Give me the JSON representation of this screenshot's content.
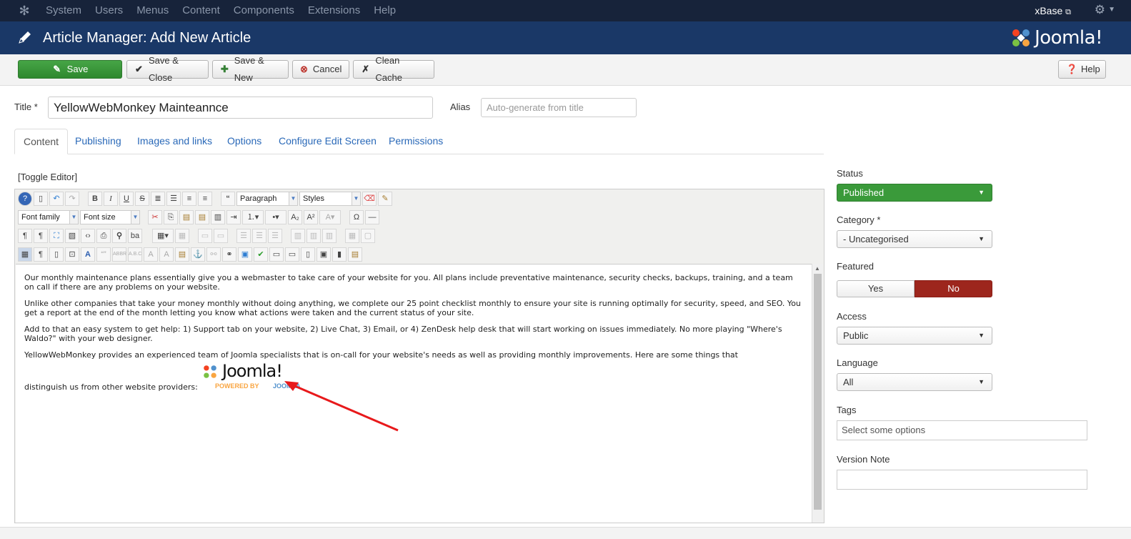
{
  "navbar": {
    "menu": [
      "System",
      "Users",
      "Menus",
      "Content",
      "Components",
      "Extensions",
      "Help"
    ],
    "site_name": "xBase"
  },
  "header": {
    "title": "Article Manager: Add New Article",
    "brand": "Joomla!"
  },
  "toolbar": {
    "save": "Save",
    "save_close": "Save & Close",
    "save_new": "Save & New",
    "cancel": "Cancel",
    "clean_cache": "Clean Cache",
    "help": "Help"
  },
  "form": {
    "title_label": "Title *",
    "title_value": "YellowWebMonkey Mainteannce",
    "alias_label": "Alias",
    "alias_placeholder": "Auto-generate from title"
  },
  "tabs": [
    "Content",
    "Publishing",
    "Images and links",
    "Options",
    "Configure Edit Screen",
    "Permissions"
  ],
  "editor": {
    "toggle": "[Toggle Editor]",
    "paragraph_select": "Paragraph",
    "styles_select": "Styles",
    "font_family": "Font family",
    "font_size": "Font size",
    "paragraphs": [
      "Our monthly maintenance plans essentially give you a webmaster to take care of your website for you. All plans include preventative maintenance, security checks, backups, training, and a team on call if there are any problems on your website.",
      "Unlike other companies that take your money monthly without doing anything, we complete our 25 point checklist monthly to ensure your site is running optimally for security, speed, and SEO. You get a report at the end of the month letting you know what actions were taken and the current status of your site.",
      "Add to that an easy system to get help: 1) Support tab on your website, 2) Live Chat, 3) Email, or 4) ZenDesk help desk that will start working on issues immediately. No more playing \"Where's Waldo?\" with your web designer.",
      "YellowWebMonkey provides an experienced team of Joomla specialists that is on-call for your website's needs as well as providing monthly improvements. Here are some things that"
    ],
    "last_line": "distinguish us from other website providers:",
    "inline_logo": "Joomla!",
    "powered_by": "POWERED BY",
    "powered_joomla": "JOOMLA"
  },
  "sidebar": {
    "status_label": "Status",
    "status_value": "Published",
    "category_label": "Category *",
    "category_value": "- Uncategorised",
    "featured_label": "Featured",
    "featured_yes": "Yes",
    "featured_no": "No",
    "access_label": "Access",
    "access_value": "Public",
    "language_label": "Language",
    "language_value": "All",
    "tags_label": "Tags",
    "tags_placeholder": "Select some options",
    "version_label": "Version Note",
    "version_value": ""
  },
  "colors": {
    "navbar": "#17233a",
    "header": "#1a3867",
    "save_green": "#3a9a3a",
    "no_red": "#9d261d",
    "link_blue": "#2a69b8",
    "arrow_red": "#e8191b"
  }
}
